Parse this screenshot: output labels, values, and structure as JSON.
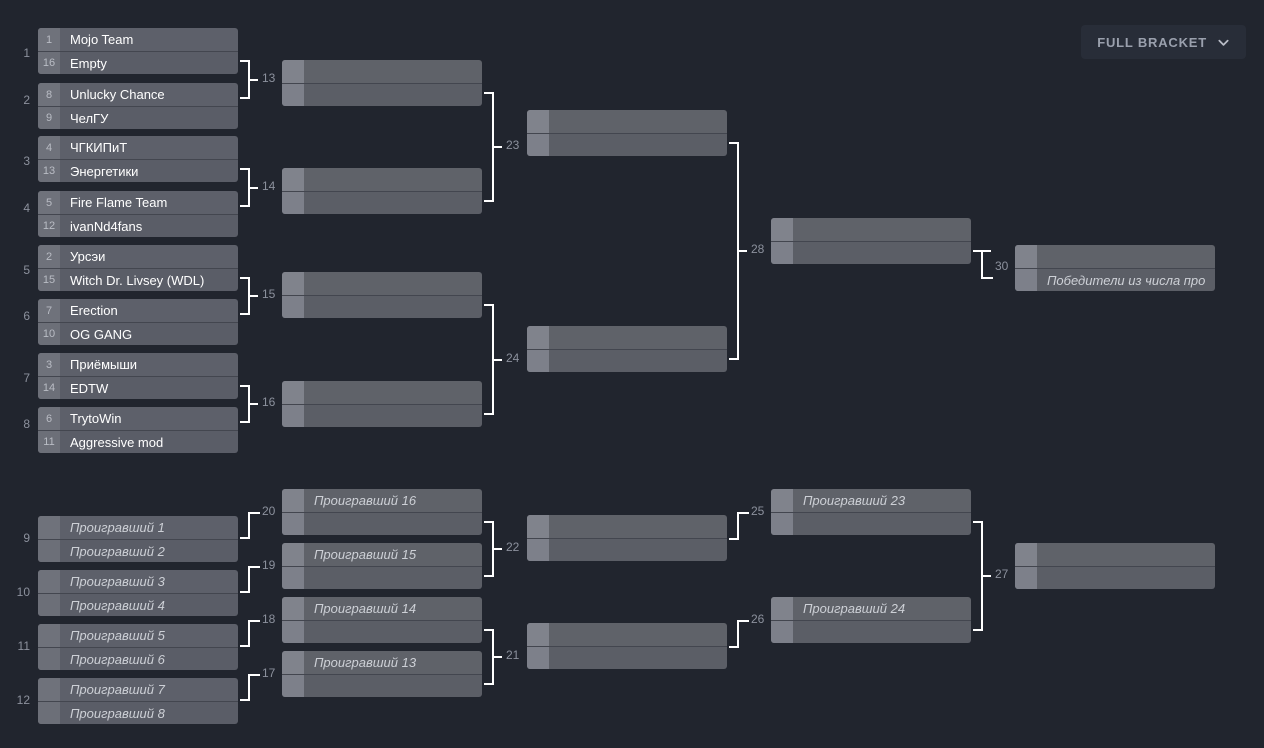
{
  "toolbar": {
    "full_bracket_label": "FULL BRACKET",
    "chevron_icon": "chevron-down-icon"
  },
  "colors": {
    "page_background": "#21252e",
    "box_fill": "#5d606a",
    "box_fill_empty": "#5f6269",
    "seed_fill": "#6f727b",
    "seed_fill_empty": "#80838c",
    "connector": "#ffffff",
    "match_number": "#8c919d",
    "team_text": "#ffffff",
    "placeholder_text": "#cdd0d6",
    "toolbar_bg": "#282d38",
    "toolbar_text": "#9aa0ad"
  },
  "upper_bracket": {
    "round1": [
      {
        "index": "1",
        "seeds": [
          "1",
          "16"
        ],
        "teams": [
          "Mojo Team",
          "Empty"
        ]
      },
      {
        "index": "2",
        "seeds": [
          "8",
          "9"
        ],
        "teams": [
          "Unlucky Chance",
          "ЧелГУ"
        ]
      },
      {
        "index": "3",
        "seeds": [
          "4",
          "13"
        ],
        "teams": [
          "ЧГКИПиТ",
          "Энергетики"
        ]
      },
      {
        "index": "4",
        "seeds": [
          "5",
          "12"
        ],
        "teams": [
          "Fire Flame Team",
          "ivanNd4fans"
        ]
      },
      {
        "index": "5",
        "seeds": [
          "2",
          "15"
        ],
        "teams": [
          "Урсэи",
          "Witch Dr. Livsey (WDL)"
        ]
      },
      {
        "index": "6",
        "seeds": [
          "7",
          "10"
        ],
        "teams": [
          "Erection",
          "OG GANG"
        ]
      },
      {
        "index": "7",
        "seeds": [
          "3",
          "14"
        ],
        "teams": [
          "Приёмыши",
          "EDTW"
        ]
      },
      {
        "index": "8",
        "seeds": [
          "6",
          "11"
        ],
        "teams": [
          "TrytoWin",
          "Aggressive mod"
        ]
      }
    ],
    "round2": [
      {
        "number": "13",
        "teams": [
          "",
          ""
        ]
      },
      {
        "number": "14",
        "teams": [
          "",
          ""
        ]
      },
      {
        "number": "15",
        "teams": [
          "",
          ""
        ]
      },
      {
        "number": "16",
        "teams": [
          "",
          ""
        ]
      }
    ],
    "round3": [
      {
        "number": "23",
        "teams": [
          "",
          ""
        ]
      },
      {
        "number": "24",
        "teams": [
          "",
          ""
        ]
      }
    ],
    "round4": [
      {
        "number": "28",
        "teams": [
          "",
          ""
        ]
      }
    ],
    "grand_final": [
      {
        "number": "30",
        "teams": [
          "",
          "Победители из числа про"
        ]
      }
    ]
  },
  "lower_bracket": {
    "round1": [
      {
        "index": "9",
        "number": "20",
        "teams": [
          "Проигравший 1",
          "Проигравший 2"
        ]
      },
      {
        "index": "10",
        "number": "19",
        "teams": [
          "Проигравший 3",
          "Проигравший 4"
        ]
      },
      {
        "index": "11",
        "number": "18",
        "teams": [
          "Проигравший 5",
          "Проигравший 6"
        ]
      },
      {
        "index": "12",
        "number": "17",
        "teams": [
          "Проигравший 7",
          "Проигравший 8"
        ]
      }
    ],
    "round2": [
      {
        "teams": [
          "Проигравший 16",
          ""
        ]
      },
      {
        "teams": [
          "Проигравший 15",
          ""
        ]
      },
      {
        "teams": [
          "Проигравший 14",
          ""
        ]
      },
      {
        "teams": [
          "Проигравший 13",
          ""
        ]
      }
    ],
    "round3": [
      {
        "number": "22",
        "teams": [
          "",
          ""
        ]
      },
      {
        "number": "21",
        "teams": [
          "",
          ""
        ]
      }
    ],
    "round4": [
      {
        "number": "25",
        "teams": [
          "Проигравший 23",
          ""
        ]
      },
      {
        "number": "26",
        "teams": [
          "Проигравший 24",
          ""
        ]
      }
    ],
    "round5": [
      {
        "number": "27",
        "teams": [
          "",
          ""
        ]
      }
    ]
  }
}
